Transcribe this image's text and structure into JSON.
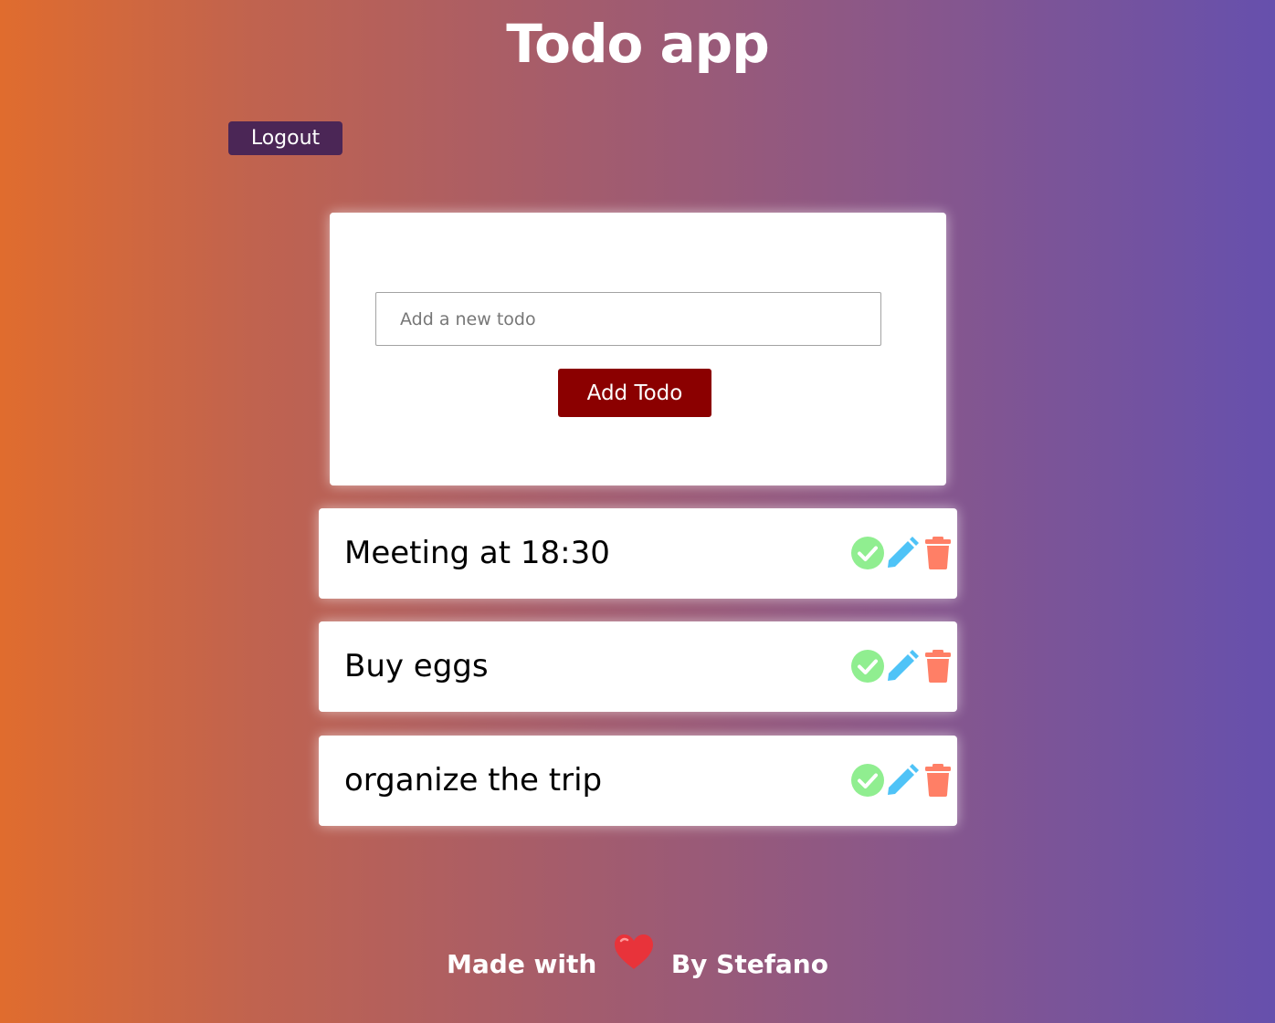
{
  "header": {
    "title": "Todo app"
  },
  "auth": {
    "logout_label": "Logout"
  },
  "form": {
    "placeholder": "Add a new todo",
    "add_label": "Add Todo"
  },
  "todos": [
    {
      "text": "Meeting at 18:30"
    },
    {
      "text": "Buy eggs"
    },
    {
      "text": "organize the trip"
    }
  ],
  "todo_actions": {
    "complete_icon": "check-circle-icon",
    "edit_icon": "pencil-icon",
    "delete_icon": "trash-icon"
  },
  "footer": {
    "made_with": "Made with",
    "heart_icon": "heart-icon",
    "by": "By Stefano"
  },
  "colors": {
    "gradient_start": "#e06c2e",
    "gradient_end": "#6650ad",
    "logout_bg": "#4b2656",
    "add_button_bg": "#8b0000",
    "complete_icon": "#90ee90",
    "edit_icon": "#4fc3f7",
    "delete_icon": "#ff7f66",
    "heart": "#e8333a"
  }
}
